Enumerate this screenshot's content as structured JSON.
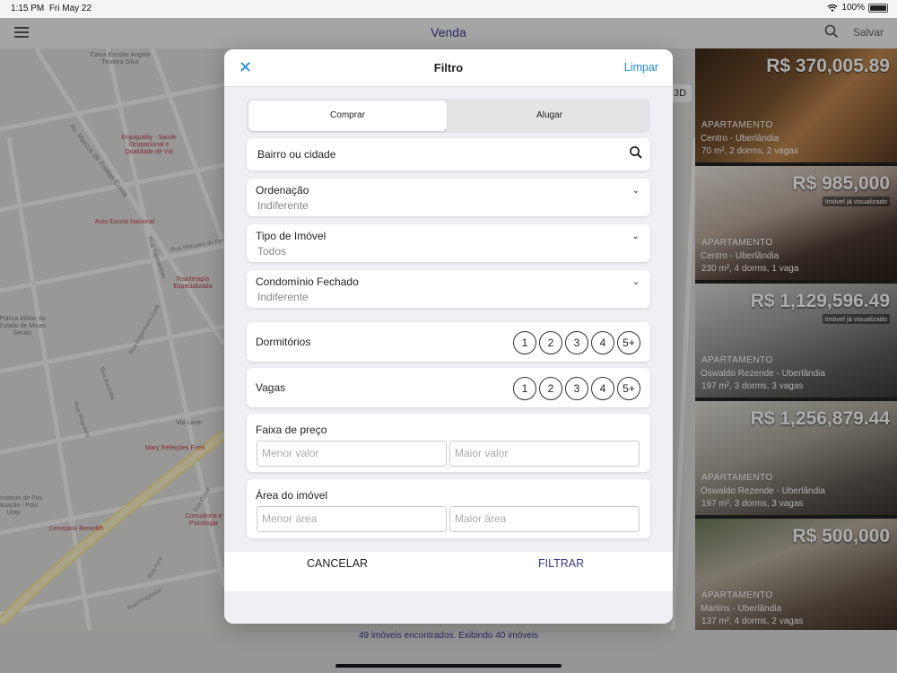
{
  "status_bar": {
    "time": "1:15 PM",
    "date": "Fri May 22",
    "battery": "100%"
  },
  "nav": {
    "title": "Venda",
    "save_label": "Salvar"
  },
  "map": {
    "pois": [
      "Caixa Escolar Angela Teixeira Silva",
      "Ergoquality - Saúde Ocupacional e Qualidade de Vid",
      "Auto Escola Nacional",
      "Fisioterapia Especializada",
      "Polícia Militar do Estado de Minas Gerais",
      "Via Lazer",
      "Mary Refeições Eireli",
      "Ipg - Instituto de Pós Graduação / Polo Unip",
      "Cervejaria Benedith",
      "Consultoria e Psicologia"
    ],
    "streets": [
      "Av. Marcos de Freitas Costa",
      "Rua Marquês de Pombal",
      "Rua Engenheiro Azeli",
      "Rua Ituiutaba",
      "Rua Vergueiro",
      "Rua Tupinambás",
      "Rua Progresso",
      "Rua Acre",
      "Rua Cocal"
    ],
    "badge_3d": "3D"
  },
  "listings": [
    {
      "price": "R$ 370,005.89",
      "type": "APARTAMENTO",
      "location": "Centro - Uberlândia",
      "desc": "70 m², 2 dorms, 2 vagas",
      "seen": ""
    },
    {
      "price": "R$ 985,000",
      "type": "APARTAMENTO",
      "location": "Centro - Uberlândia",
      "desc": "230 m², 4 dorms, 1 vaga",
      "seen": "Imóvel já visualizado"
    },
    {
      "price": "R$ 1,129,596.49",
      "type": "APARTAMENTO",
      "location": "Oswaldo Rezende - Uberlândia",
      "desc": "197 m², 3 dorms, 3 vagas",
      "seen": "Imóvel já visualizado"
    },
    {
      "price": "R$ 1,256,879.44",
      "type": "APARTAMENTO",
      "location": "Oswaldo Rezende - Uberlândia",
      "desc": "197 m², 3 dorms, 3 vagas",
      "seen": ""
    },
    {
      "price": "R$ 500,000",
      "type": "APARTAMENTO",
      "location": "Martins - Uberlândia",
      "desc": "137 m², 4 dorms, 2 vagas",
      "seen": ""
    }
  ],
  "footer": {
    "results_text": "49 imóveis encontrados. Exibindo 40 imóveis"
  },
  "filter": {
    "title": "Filtro",
    "clear_label": "Limpar",
    "close_symbol": "✕",
    "segments": {
      "buy": "Comprar",
      "rent": "Alugar"
    },
    "search": {
      "text": "Bairro ou cidade"
    },
    "sort": {
      "label": "Ordenação",
      "value": "Indiferente"
    },
    "property_type": {
      "label": "Tipo de Imóvel",
      "value": "Todos"
    },
    "gated": {
      "label": "Condomínio Fechado",
      "value": "Indiferente"
    },
    "bedrooms": {
      "label": "Dormitórios",
      "options": [
        "1",
        "2",
        "3",
        "4",
        "5+"
      ]
    },
    "parking": {
      "label": "Vagas",
      "options": [
        "1",
        "2",
        "3",
        "4",
        "5+"
      ]
    },
    "price_range": {
      "label": "Faixa de preço",
      "min_placeholder": "Menor valor",
      "max_placeholder": "Maior valor"
    },
    "area": {
      "label": "Área do imóvel",
      "min_placeholder": "Menor área",
      "max_placeholder": "Maior área"
    },
    "cancel_label": "CANCELAR",
    "apply_label": "FILTRAR"
  }
}
